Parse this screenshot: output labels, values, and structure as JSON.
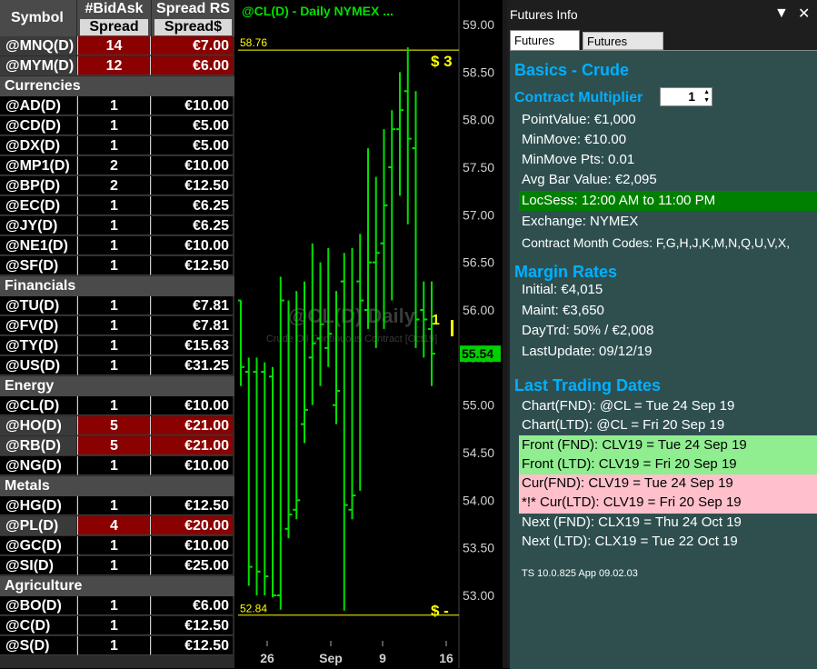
{
  "watchlist": {
    "headers": {
      "symbol": "Symbol",
      "col1_top": "#BidAsk",
      "col1_sub": "Spread",
      "col2_top": "Spread RS",
      "col2_sub": "Spread$"
    },
    "rows": [
      {
        "type": "sym",
        "symbol": "@MNQ(D)",
        "bidask": "14",
        "spread": "€7.00",
        "highlight": true
      },
      {
        "type": "sym",
        "symbol": "@MYM(D)",
        "bidask": "12",
        "spread": "€6.00",
        "highlight": true
      },
      {
        "type": "cat",
        "label": "Currencies"
      },
      {
        "type": "sym",
        "symbol": "@AD(D)",
        "bidask": "1",
        "spread": "€10.00"
      },
      {
        "type": "sym",
        "symbol": "@CD(D)",
        "bidask": "1",
        "spread": "€5.00"
      },
      {
        "type": "sym",
        "symbol": "@DX(D)",
        "bidask": "1",
        "spread": "€5.00"
      },
      {
        "type": "sym",
        "symbol": "@MP1(D)",
        "bidask": "2",
        "spread": "€10.00"
      },
      {
        "type": "sym",
        "symbol": "@BP(D)",
        "bidask": "2",
        "spread": "€12.50"
      },
      {
        "type": "sym",
        "symbol": "@EC(D)",
        "bidask": "1",
        "spread": "€6.25"
      },
      {
        "type": "sym",
        "symbol": "@JY(D)",
        "bidask": "1",
        "spread": "€6.25"
      },
      {
        "type": "sym",
        "symbol": "@NE1(D)",
        "bidask": "1",
        "spread": "€10.00"
      },
      {
        "type": "sym",
        "symbol": "@SF(D)",
        "bidask": "1",
        "spread": "€12.50"
      },
      {
        "type": "cat",
        "label": "Financials"
      },
      {
        "type": "sym",
        "symbol": "@TU(D)",
        "bidask": "1",
        "spread": "€7.81"
      },
      {
        "type": "sym",
        "symbol": "@FV(D)",
        "bidask": "1",
        "spread": "€7.81"
      },
      {
        "type": "sym",
        "symbol": "@TY(D)",
        "bidask": "1",
        "spread": "€15.63"
      },
      {
        "type": "sym",
        "symbol": "@US(D)",
        "bidask": "1",
        "spread": "€31.25"
      },
      {
        "type": "cat",
        "label": "Energy"
      },
      {
        "type": "sym",
        "symbol": "@CL(D)",
        "bidask": "1",
        "spread": "€10.00"
      },
      {
        "type": "sym",
        "symbol": "@HO(D)",
        "bidask": "5",
        "spread": "€21.00",
        "highlight": true
      },
      {
        "type": "sym",
        "symbol": "@RB(D)",
        "bidask": "5",
        "spread": "€21.00",
        "highlight": true
      },
      {
        "type": "sym",
        "symbol": "@NG(D)",
        "bidask": "1",
        "spread": "€10.00"
      },
      {
        "type": "cat",
        "label": "Metals"
      },
      {
        "type": "sym",
        "symbol": "@HG(D)",
        "bidask": "1",
        "spread": "€12.50"
      },
      {
        "type": "sym",
        "symbol": "@PL(D)",
        "bidask": "4",
        "spread": "€20.00",
        "highlight": true
      },
      {
        "type": "sym",
        "symbol": "@GC(D)",
        "bidask": "1",
        "spread": "€10.00"
      },
      {
        "type": "sym",
        "symbol": "@SI(D)",
        "bidask": "1",
        "spread": "€25.00"
      },
      {
        "type": "cat",
        "label": "Agriculture"
      },
      {
        "type": "sym",
        "symbol": "@BO(D)",
        "bidask": "1",
        "spread": "€6.00"
      },
      {
        "type": "sym",
        "symbol": "@C(D)",
        "bidask": "1",
        "spread": "€12.50"
      },
      {
        "type": "sym",
        "symbol": "@S(D)",
        "bidask": "1",
        "spread": "€12.50"
      }
    ]
  },
  "chart": {
    "title": "@CL(D) - Daily  NYMEX  ...",
    "watermark": "@CL(D) Daily",
    "watermark_sub": "Crude Oil Continuous Contract [Oct19]",
    "colors": {
      "bar": "#00e000",
      "accent": "#ffff00",
      "last_bg": "#00d000"
    },
    "high_line": "58.76",
    "low_line": "52.84",
    "high_label": "$ 3",
    "low_label": "$ -",
    "marker_label": "1",
    "last_price": "55.54"
  },
  "chart_data": {
    "type": "ohlc",
    "y_ticks": [
      "59.00",
      "58.50",
      "58.00",
      "57.50",
      "57.00",
      "56.50",
      "56.00",
      "55.50",
      "55.00",
      "54.50",
      "54.00",
      "53.50",
      "53.00"
    ],
    "ylim": [
      52.7,
      59.2
    ],
    "x_ticks": [
      "26",
      "Sep",
      "9",
      "16"
    ],
    "bars": [
      {
        "o": 56.1,
        "h": 56.1,
        "l": 55.2,
        "c": 55.4
      },
      {
        "o": 55.35,
        "h": 55.5,
        "l": 53.1,
        "c": 53.3
      },
      {
        "o": 55.35,
        "h": 55.5,
        "l": 53.0,
        "c": 53.25
      },
      {
        "o": 55.35,
        "h": 55.45,
        "l": 53.0,
        "c": 53.2
      },
      {
        "o": 55.3,
        "h": 55.4,
        "l": 52.98,
        "c": 53.0
      },
      {
        "o": 53.0,
        "h": 56.35,
        "l": 52.85,
        "c": 56.1
      },
      {
        "o": 53.7,
        "h": 56.1,
        "l": 53.6,
        "c": 53.85
      },
      {
        "o": 53.9,
        "h": 56.2,
        "l": 53.8,
        "c": 54.0
      },
      {
        "o": 54.8,
        "h": 56.3,
        "l": 54.6,
        "c": 54.95
      },
      {
        "o": 55.5,
        "h": 56.7,
        "l": 55.0,
        "c": 55.65
      },
      {
        "o": 55.7,
        "h": 56.5,
        "l": 55.2,
        "c": 55.85
      },
      {
        "o": 55.6,
        "h": 56.65,
        "l": 55.4,
        "c": 55.75
      },
      {
        "o": 55.0,
        "h": 56.2,
        "l": 54.8,
        "c": 55.15
      },
      {
        "o": 56.3,
        "h": 56.6,
        "l": 52.84,
        "c": 53.95
      },
      {
        "o": 53.9,
        "h": 56.65,
        "l": 53.8,
        "c": 54.05
      },
      {
        "o": 56.3,
        "h": 56.8,
        "l": 54.1,
        "c": 56.1
      },
      {
        "o": 56.0,
        "h": 57.7,
        "l": 55.8,
        "c": 56.5
      },
      {
        "o": 56.5,
        "h": 57.4,
        "l": 55.6,
        "c": 56.6
      },
      {
        "o": 56.7,
        "h": 57.9,
        "l": 55.8,
        "c": 57.1
      },
      {
        "o": 57.5,
        "h": 58.1,
        "l": 56.1,
        "c": 57.9
      },
      {
        "o": 57.9,
        "h": 58.5,
        "l": 57.2,
        "c": 58.1
      },
      {
        "o": 58.3,
        "h": 58.76,
        "l": 56.9,
        "c": 57.8
      },
      {
        "o": 57.7,
        "h": 58.3,
        "l": 55.6,
        "c": 55.9
      },
      {
        "o": 56.0,
        "h": 56.3,
        "l": 55.5,
        "c": 55.9
      },
      {
        "o": 55.8,
        "h": 56.3,
        "l": 55.2,
        "c": 55.54
      }
    ]
  },
  "panel": {
    "title": "Futures Info",
    "tabs": [
      "Futures Info",
      "Futures Chain"
    ],
    "colors": {
      "bg": "#2f4f4f",
      "section": "#00b0ff",
      "locsess_bg": "#008000",
      "front_bg": "#90ee90",
      "cur_bg": "#ffc0cb"
    },
    "basics_title": "Basics - Crude",
    "multiplier_label": "Contract Multiplier",
    "multiplier_value": "1",
    "point_value": "PointValue: €1,000",
    "min_move": "MinMove: €10.00",
    "min_move_pts": "MinMove Pts: 0.01",
    "avg_bar": "Avg Bar Value: €2,095",
    "locsess": "LocSess: 12:00 AM to 11:00 PM",
    "exchange": "Exchange: NYMEX",
    "month_codes": "Contract Month Codes: F,G,H,J,K,M,N,Q,U,V,X,",
    "margin_title": "Margin Rates",
    "initial": "Initial: €4,015",
    "maint": "Maint: €3,650",
    "daytrd": "DayTrd: 50% / €2,008",
    "last_update": "LastUpdate: 09/12/19",
    "ltd_title": "Last Trading Dates",
    "chart_fnd": "Chart(FND): @CL = Tue 24 Sep 19",
    "chart_ltd": "Chart(LTD): @CL = Fri 20 Sep 19",
    "front_fnd": "Front (FND): CLV19 = Tue 24 Sep 19",
    "front_ltd": "Front (LTD): CLV19 = Fri 20 Sep 19",
    "cur_fnd": "Cur(FND): CLV19 = Tue 24 Sep 19",
    "cur_ltd": "*!* Cur(LTD): CLV19 = Fri 20 Sep 19",
    "next_fnd": "Next (FND): CLX19 = Thu 24 Oct 19",
    "next_ltd": "Next (LTD): CLX19 = Tue 22 Oct 19",
    "footer": "TS 10.0.825  App 09.02.03"
  }
}
